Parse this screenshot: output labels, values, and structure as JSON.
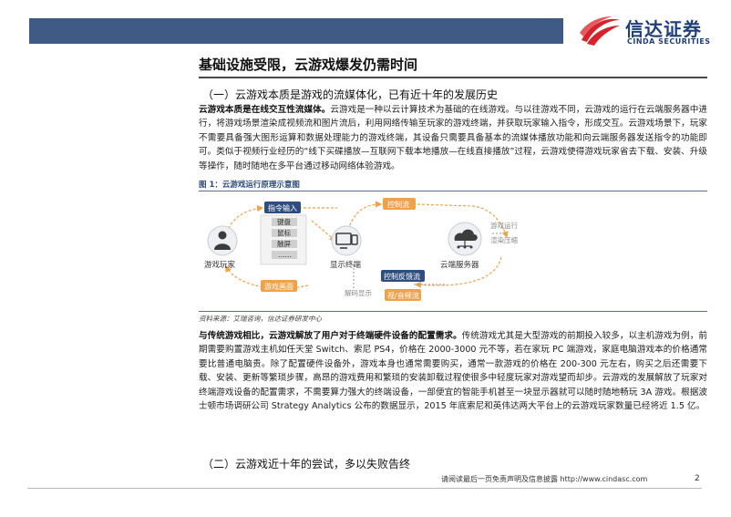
{
  "header": {
    "logo_cn": "信达证券",
    "logo_en": "CINDA SECURITIES",
    "bar_color": "#3f5a85",
    "logo_colors": [
      "#d6232b",
      "#1f3f7a"
    ]
  },
  "section": {
    "title": "基础设施受限，云游戏爆发仍需时间"
  },
  "subsection1": {
    "title": "（一）云游戏本质是游戏的流媒体化，已有近十年的发展历史"
  },
  "paragraph1": {
    "lead": "云游戏本质是在线交互性流媒体。",
    "body": "云游戏是一种以云计算技术为基础的在线游戏。与以往游戏不同，云游戏的运行在云端服务器中进行，将游戏场景渲染成视频流和图片流后，利用网络传输至玩家的游戏终端，并获取玩家输入指令，形成交互。云游戏场景下，玩家不需要具备强大图形运算和数据处理能力的游戏终端，其设备只需要具备基本的流媒体播放功能和向云端服务器发送指令的功能即可。类似于视频行业经历的“线下买碟播放—互联网下载本地播放—在线直接播放”过程，云游戏使得游戏玩家省去下载、安装、升级等操作，随时随地在多平台通过移动网络体验游戏。"
  },
  "figure": {
    "caption": "图 1：云游戏运行原理示意图",
    "source": "资料来源：艾瑞咨询，信达证券研发中心",
    "nodes": {
      "player": "游戏玩家",
      "display": "显示终端",
      "server": "云端服务器"
    },
    "pills": {
      "command_input": "指令输入",
      "control_stream": "控制流",
      "game_screen": "游戏画面",
      "control_feedback": "控制反馈流",
      "av_stream": "视/音频流"
    },
    "inputs": [
      "键盘",
      "鼠标",
      "触屏",
      "……"
    ],
    "server_steps": [
      "游戏运行",
      "渲染压缩"
    ],
    "decode_label": "解码显示",
    "colors": {
      "orange": "#f0a14a",
      "orange_light": "#fbe3c4",
      "blue": "#2f4e80",
      "icon_gray": "#3c3c3c"
    }
  },
  "paragraph2": {
    "lead": "与传统游戏相比，云游戏解放了用户对于终端硬件设备的配置需求。",
    "body": "传统游戏尤其是大型游戏的前期投入较多，以主机游戏为例，前期需要购置游戏主机如任天堂 Switch、索尼 PS4，价格在 2000-3000 元不等，若在家玩 PC 端游戏，家庭电脑游戏本的价格通常要比普通电脑贵。除了配置硬件设备外，游戏本身也通常需要购买，通常一款游戏的价格在 200-300 元左右，购买之后还需要下载、安装、更新等繁琐步骤，高昂的游戏费用和繁琐的安装卸载过程使很多中轻度玩家对游戏望而却步。云游戏的发展解放了玩家对终端游戏设备的配置需求，不需要算力强大的终端设备，一部便宜的智能手机甚至一块显示器就可以随时随地畅玩 3A 游戏。根据波士顿市场调研公司 Strategy Analytics 公布的数据显示，2015 年底索尼和英伟达两大平台上的云游戏玩家数量已经将近 1.5 亿。"
  },
  "subsection2": {
    "title": "（二）云游戏近十年的尝试，多以失败告终"
  },
  "footer": {
    "disclaimer": "请阅读最后一页免责声明及信息披露 http://www.cindasc.com",
    "page_number": "2"
  }
}
